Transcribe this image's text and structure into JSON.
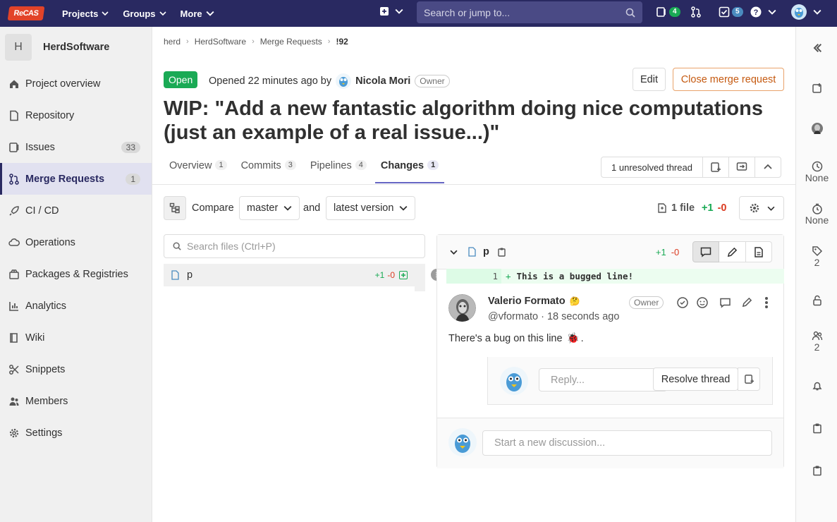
{
  "topbar": {
    "logo_text": "ReCAS",
    "nav": [
      "Projects",
      "Groups",
      "More"
    ],
    "search_placeholder": "Search or jump to...",
    "issues_count": "4",
    "todos_count": "5"
  },
  "sidebar": {
    "project_initial": "H",
    "project_name": "HerdSoftware",
    "items": [
      {
        "label": "Project overview",
        "icon": "home-icon"
      },
      {
        "label": "Repository",
        "icon": "doc-icon"
      },
      {
        "label": "Issues",
        "icon": "issues-icon",
        "count": "33"
      },
      {
        "label": "Merge Requests",
        "icon": "merge-request-icon",
        "count": "1",
        "active": true
      },
      {
        "label": "CI / CD",
        "icon": "rocket-icon"
      },
      {
        "label": "Operations",
        "icon": "cloud-gear-icon"
      },
      {
        "label": "Packages & Registries",
        "icon": "package-icon"
      },
      {
        "label": "Analytics",
        "icon": "chart-icon"
      },
      {
        "label": "Wiki",
        "icon": "book-icon"
      },
      {
        "label": "Snippets",
        "icon": "scissors-icon"
      },
      {
        "label": "Members",
        "icon": "users-icon"
      },
      {
        "label": "Settings",
        "icon": "settings-icon"
      }
    ]
  },
  "breadcrumb": [
    "herd",
    "HerdSoftware",
    "Merge Requests",
    "!92"
  ],
  "mr": {
    "status": "Open",
    "opened": "Opened 22 minutes ago by",
    "author": "Nicola Mori",
    "author_role": "Owner",
    "edit_label": "Edit",
    "close_label": "Close merge request",
    "title": "WIP: \"Add a new fantastic algorithm doing nice computations (just an example of a real issue...)\""
  },
  "tabs": [
    {
      "label": "Overview",
      "count": "1"
    },
    {
      "label": "Commits",
      "count": "3"
    },
    {
      "label": "Pipelines",
      "count": "4"
    },
    {
      "label": "Changes",
      "count": "1",
      "active": true
    }
  ],
  "threads": {
    "unresolved_label": "1 unresolved thread"
  },
  "compare": {
    "label": "Compare",
    "source": "master",
    "and": "and",
    "target": "latest version"
  },
  "diffstats": {
    "files": "1 file",
    "added": "+1",
    "removed": "-0"
  },
  "file_search_placeholder": "Search files (Ctrl+P)",
  "filetree": [
    {
      "name": "p",
      "added": "+1",
      "removed": "-0"
    }
  ],
  "diff": {
    "filename": "p",
    "added": "+1",
    "removed": "-0",
    "line_number": "1",
    "line_marker": "+",
    "line_text": "This is a bugged line!"
  },
  "note": {
    "author": "Valerio Formato",
    "emoji": "🤔",
    "role": "Owner",
    "handle": "@vformato",
    "time": "· 18 seconds ago",
    "body": "There's a bug on this line",
    "body_emoji": "🐞",
    "body_end": "."
  },
  "reply": {
    "placeholder": "Reply...",
    "resolve_label": "Resolve thread"
  },
  "new_discussion_placeholder": "Start a new discussion...",
  "right_sidebar": {
    "assignee": "None",
    "milestone": "None",
    "labels": "2",
    "participants": "2"
  },
  "colors": {
    "topbar": "#292961",
    "open": "#1aaa55",
    "added_line": "#ecfdf0",
    "warn": "#c55a11"
  }
}
